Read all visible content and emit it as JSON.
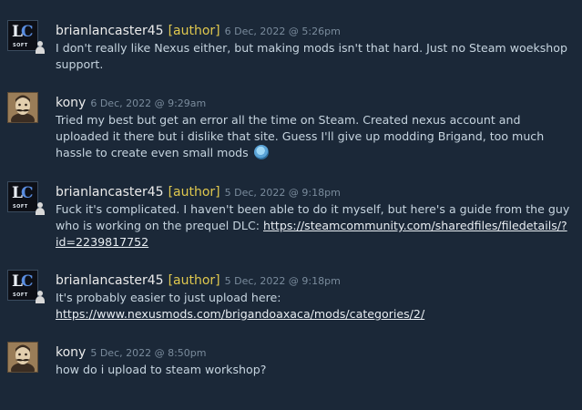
{
  "comments": [
    {
      "author": "brianlancaster45",
      "author_tag": "[author]",
      "timestamp": "6 Dec, 2022 @ 5:26pm",
      "text": "I don't really like Nexus either, but making mods isn't that hard. Just no Steam woekshop support.",
      "avatar": "lc-soft-logo"
    },
    {
      "author": "kony",
      "timestamp": "6 Dec, 2022 @ 9:29am",
      "text": "Tried my best but get an error all the time on Steam. Created nexus account and uploaded it there but i dislike that site. Guess I'll give up modding Brigand, too much hassle to create even small mods",
      "emoticon": "blue-emoticon",
      "avatar": "mustached-man-portrait"
    },
    {
      "author": "brianlancaster45",
      "author_tag": "[author]",
      "timestamp": "5 Dec, 2022 @ 9:18pm",
      "text": "Fuck it's complicated. I haven't been able to do it myself, but here's a guide from the guy who is working on the prequel DLC: ",
      "link": "https://steamcommunity.com/sharedfiles/filedetails/?id=2239817752",
      "avatar": "lc-soft-logo"
    },
    {
      "author": "brianlancaster45",
      "author_tag": "[author]",
      "timestamp": "5 Dec, 2022 @ 9:18pm",
      "text": "It's probably easier to just upload here:",
      "link": "https://www.nexusmods.com/brigandoaxaca/mods/categories/2/",
      "avatar": "lc-soft-logo"
    },
    {
      "author": "kony",
      "timestamp": "5 Dec, 2022 @ 8:50pm",
      "text": "how do i upload to steam workshop?",
      "avatar": "mustached-man-portrait"
    }
  ],
  "logo_text": {
    "l": "L",
    "c": "C",
    "soft": "SOFT"
  },
  "colors": {
    "background": "#1b2838",
    "author_tag": "#e0c84e",
    "timestamp": "#7a8b9c",
    "body_text": "#c6d4df"
  }
}
